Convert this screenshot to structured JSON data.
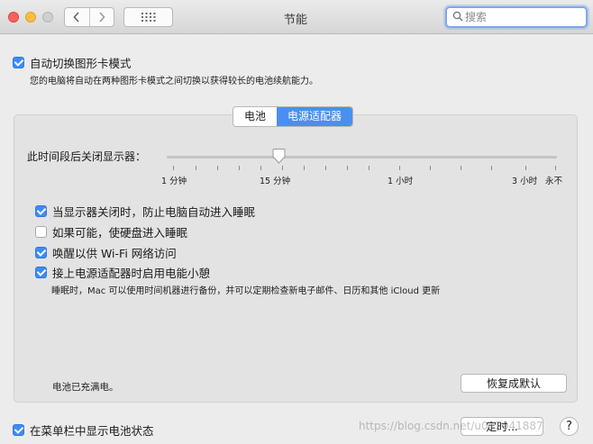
{
  "window": {
    "title": "节能"
  },
  "search": {
    "value": "",
    "placeholder": "搜索"
  },
  "auto_switch": {
    "checked": true,
    "label": "自动切换图形卡模式",
    "description": "您的电脑将自动在两种图形卡模式之间切换以获得较长的电池续航能力。"
  },
  "tabs": [
    {
      "label": "电池",
      "active": false
    },
    {
      "label": "电源适配器",
      "active": true
    }
  ],
  "display_sleep": {
    "label": "此时间段后关闭显示器：",
    "ticks": [
      "1 分钟",
      "15 分钟",
      "1 小时",
      "3 小时",
      "永不"
    ],
    "current": "15 分钟"
  },
  "options": [
    {
      "checked": true,
      "label": "当显示器关闭时，防止电脑自动进入睡眠"
    },
    {
      "checked": false,
      "label": "如果可能，使硬盘进入睡眠"
    },
    {
      "checked": true,
      "label": "唤醒以供 Wi-Fi 网络访问"
    },
    {
      "checked": true,
      "label": "接上电源适配器时启用电能小憩"
    }
  ],
  "power_nap_note": "睡眠时，Mac 可以使用时间机器进行备份，并可以定期检查新电子邮件、日历和其他 iCloud 更新",
  "battery_status": "电池已充满电。",
  "restore_default_label": "恢复成默认",
  "menu_bar": {
    "checked": true,
    "label": "在菜单栏中显示电池状态"
  },
  "schedule_label": "定时...",
  "help_label": "?",
  "watermark": "https://blog.csdn.net/u012941887"
}
